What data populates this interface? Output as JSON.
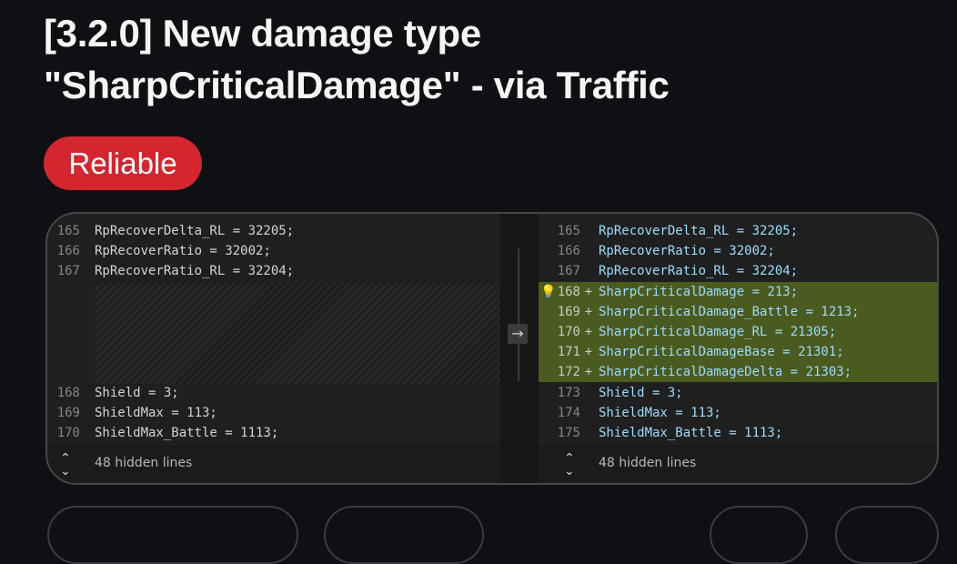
{
  "post": {
    "title_line1": "[3.2.0] New damage type",
    "title_line2": "\"SharpCriticalDamage\" - via Traffic",
    "badge": "Reliable"
  },
  "diff": {
    "left": {
      "rows_top": [
        {
          "num": "165",
          "code": "RpRecoverDelta_RL = 32205;"
        },
        {
          "num": "166",
          "code": "RpRecoverRatio = 32002;"
        },
        {
          "num": "167",
          "code": "RpRecoverRatio_RL = 32204;"
        }
      ],
      "rows_bottom": [
        {
          "num": "168",
          "code": "Shield = 3;"
        },
        {
          "num": "169",
          "code": "ShieldMax = 113;"
        },
        {
          "num": "170",
          "code": "ShieldMax_Battle = 1113;"
        }
      ],
      "footer": "48 hidden lines"
    },
    "right": {
      "rows": [
        {
          "num": "165",
          "code": "RpRecoverDelta_RL = 32205;"
        },
        {
          "num": "166",
          "code": "RpRecoverRatio = 32002;"
        },
        {
          "num": "167",
          "code": "RpRecoverRatio_RL = 32204;"
        },
        {
          "num": "168",
          "plus": "+",
          "code": "SharpCriticalDamage = 213;"
        },
        {
          "num": "169",
          "plus": "+",
          "code": "SharpCriticalDamage_Battle = 1213;"
        },
        {
          "num": "170",
          "plus": "+",
          "code": "SharpCriticalDamage_RL = 21305;"
        },
        {
          "num": "171",
          "plus": "+",
          "code": "SharpCriticalDamageBase = 21301;"
        },
        {
          "num": "172",
          "plus": "+",
          "code": "SharpCriticalDamageDelta = 21303;"
        },
        {
          "num": "173",
          "code": "Shield = 3;"
        },
        {
          "num": "174",
          "code": "ShieldMax = 113;"
        },
        {
          "num": "175",
          "code": "ShieldMax_Battle = 1113;"
        }
      ],
      "footer": "48 hidden lines"
    },
    "arrow_glyph": "→"
  },
  "icons": {
    "bulb": "lightbulb-icon",
    "expand": "chevron-up-down-icon",
    "arrow": "arrow-right-icon"
  },
  "colors": {
    "badge": "#d3262f",
    "added_row": "#4b5a1f",
    "code_keyword": "#9cdcfe"
  }
}
